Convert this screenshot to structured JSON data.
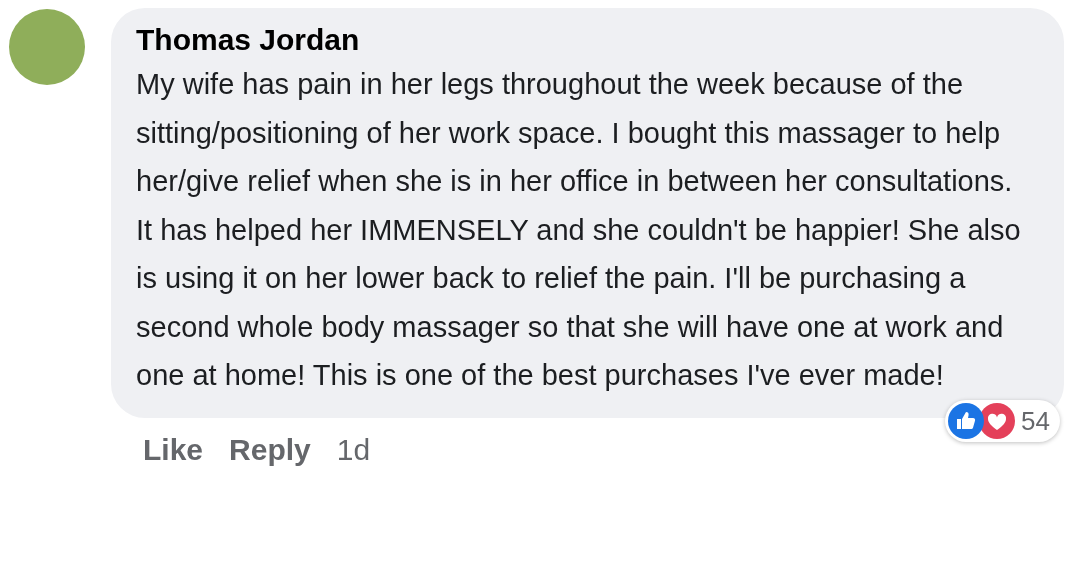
{
  "comment": {
    "author": "Thomas Jordan",
    "text": "My wife has pain in her legs throughout the week because of the sitting/positioning of her work space. I bought this massager to help her/give relief when she is in her office in between her consultations. It has helped her IMMENSELY and she couldn't be happier! She also is using it on her lower back to relief the pain. I'll be purchasing a second whole body massager so that she will have one at work and one at home! This is one of the best purchases I've ever made!",
    "reactions": {
      "like": true,
      "love": true,
      "count": "54"
    },
    "actions": [
      "Like",
      "Reply"
    ],
    "time": "1d"
  }
}
